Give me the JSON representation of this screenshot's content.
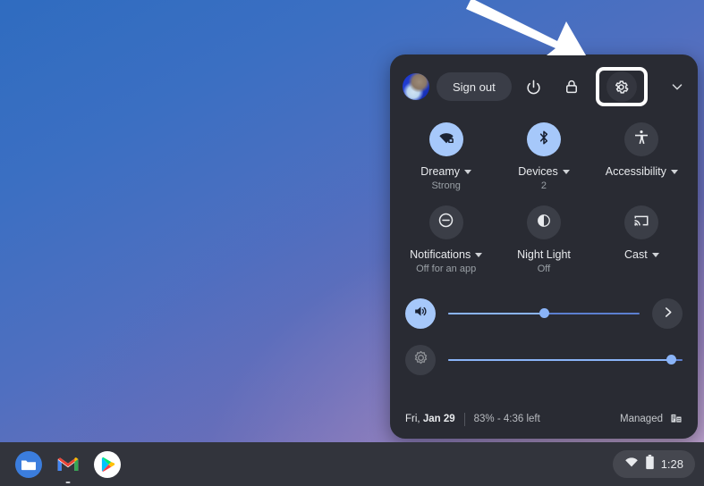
{
  "desktop": {
    "wallpaper_from": "#2f6cc0",
    "wallpaper_to": "#b193c4"
  },
  "annotation": {
    "arrow_name": "pointer-arrow",
    "arrow_color": "#ffffff",
    "points_at": "settings-gear-button"
  },
  "quick_settings": {
    "top_row": {
      "avatar_name": "user-avatar",
      "sign_out_label": "Sign out",
      "power_icon": "power-icon",
      "lock_icon": "lock-icon",
      "settings_icon": "gear-icon",
      "collapse_icon": "chevron-down-icon",
      "highlight_color": "#ffffff"
    },
    "tiles": [
      {
        "icon": "wifi-locked-icon",
        "label": "Dreamy",
        "sub": "Strong",
        "has_caret": true,
        "active": true
      },
      {
        "icon": "bluetooth-icon",
        "label": "Devices",
        "sub": "2",
        "has_caret": true,
        "active": true
      },
      {
        "icon": "accessibility-icon",
        "label": "Accessibility",
        "sub": "",
        "has_caret": true,
        "active": false
      },
      {
        "icon": "do-not-disturb-icon",
        "label": "Notifications",
        "sub": "Off for an app",
        "has_caret": true,
        "active": false
      },
      {
        "icon": "night-light-icon",
        "label": "Night Light",
        "sub": "Off",
        "has_caret": false,
        "active": false
      },
      {
        "icon": "cast-icon",
        "label": "Cast",
        "sub": "",
        "has_caret": true,
        "active": false
      }
    ],
    "sliders": [
      {
        "name": "volume",
        "icon": "volume-icon",
        "value": 50,
        "active": true,
        "has_next": true
      },
      {
        "name": "brightness",
        "icon": "brightness-icon",
        "value": 95,
        "active": false,
        "has_next": false
      }
    ],
    "footer": {
      "date_prefix": "Fri, ",
      "date_main": "Jan 29",
      "battery": "83% - 4:36 left",
      "managed_label": "Managed",
      "managed_icon": "enterprise-icon"
    }
  },
  "shelf": {
    "apps": [
      {
        "name": "files-app",
        "label": "Files",
        "running": false
      },
      {
        "name": "gmail-app",
        "label": "Gmail",
        "running": true
      },
      {
        "name": "play-store-app",
        "label": "Play Store",
        "running": false
      }
    ],
    "tray": {
      "wifi_icon": "wifi-icon",
      "battery_icon": "battery-icon",
      "clock": "1:28"
    }
  }
}
